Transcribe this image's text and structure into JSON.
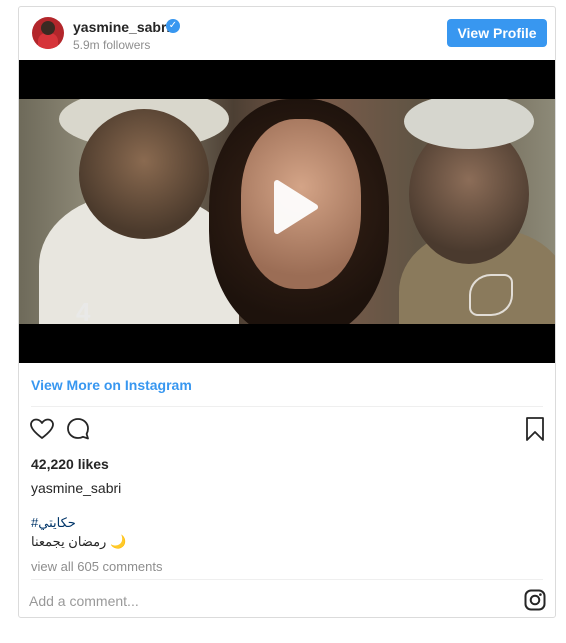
{
  "post": {
    "username": "yasmine_sabri",
    "followers": "5.9m followers",
    "view_profile_label": "View Profile",
    "view_more_label": "View More on Instagram",
    "likes": "42,220 likes",
    "caption_username": "yasmine_sabri",
    "hashtag": "#حكايتي",
    "caption_text": "رمضان يجمعنا 🌙",
    "view_comments": "view all 605 comments",
    "comment_placeholder": "Add a comment...",
    "video_logo": "4"
  },
  "icons": {
    "verified": "verified-badge-icon",
    "play": "play-icon",
    "heart": "heart-icon",
    "comment": "comment-bubble-icon",
    "bookmark": "bookmark-icon",
    "instagram": "instagram-logo-icon"
  },
  "colors": {
    "accent": "#3897f0",
    "hashtag": "#003569",
    "muted": "#8e8e8e"
  }
}
